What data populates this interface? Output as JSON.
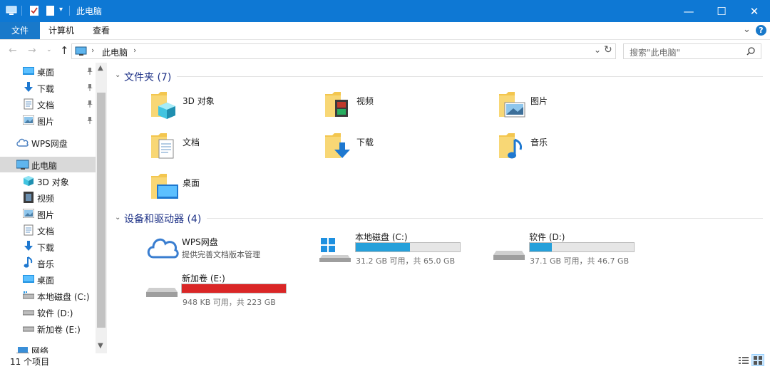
{
  "window": {
    "title": "此电脑",
    "minimize_glyph": "—",
    "maximize_glyph": "☐",
    "close_glyph": "✕"
  },
  "ribbon": {
    "tabs": [
      {
        "label": "文件",
        "active": true
      },
      {
        "label": "计算机",
        "active": false
      },
      {
        "label": "查看",
        "active": false
      }
    ],
    "expand_glyph": "⌄",
    "help_glyph": "?"
  },
  "address": {
    "path": [
      "此电脑"
    ],
    "search_placeholder": "搜索\"此电脑\""
  },
  "nav": {
    "quick_access": [
      {
        "label": "桌面",
        "icon": "desktop-icon",
        "pinned": true
      },
      {
        "label": "下载",
        "icon": "download-icon",
        "pinned": true
      },
      {
        "label": "文档",
        "icon": "document-icon",
        "pinned": true
      },
      {
        "label": "图片",
        "icon": "picture-icon",
        "pinned": true
      }
    ],
    "wps": {
      "label": "WPS网盘",
      "icon": "cloud-icon"
    },
    "this_pc": {
      "label": "此电脑",
      "icon": "computer-icon",
      "selected": true
    },
    "pc_children": [
      {
        "label": "3D 对象",
        "icon": "3d-objects-icon"
      },
      {
        "label": "视频",
        "icon": "video-icon"
      },
      {
        "label": "图片",
        "icon": "picture-icon"
      },
      {
        "label": "文档",
        "icon": "document-icon"
      },
      {
        "label": "下载",
        "icon": "download-icon"
      },
      {
        "label": "音乐",
        "icon": "music-icon"
      },
      {
        "label": "桌面",
        "icon": "desktop-icon"
      },
      {
        "label": "本地磁盘 (C:)",
        "icon": "system-drive-icon"
      },
      {
        "label": "软件 (D:)",
        "icon": "drive-icon"
      },
      {
        "label": "新加卷 (E:)",
        "icon": "drive-icon"
      }
    ],
    "network": {
      "label": "网络",
      "icon": "network-icon"
    }
  },
  "content": {
    "folders_header": "文件夹 (7)",
    "folders": [
      {
        "label": "3D 对象",
        "icon": "3d-objects-folder-icon"
      },
      {
        "label": "视频",
        "icon": "video-folder-icon"
      },
      {
        "label": "图片",
        "icon": "picture-folder-icon"
      },
      {
        "label": "文档",
        "icon": "document-folder-icon"
      },
      {
        "label": "下载",
        "icon": "download-folder-icon"
      },
      {
        "label": "音乐",
        "icon": "music-folder-icon"
      },
      {
        "label": "桌面",
        "icon": "desktop-folder-icon"
      }
    ],
    "devices_header": "设备和驱动器 (4)",
    "wps": {
      "label": "WPS网盘",
      "subtitle": "提供完善文档版本管理",
      "icon": "cloud-drive-icon"
    },
    "drives": [
      {
        "label": "本地磁盘 (C:)",
        "free": "31.2 GB 可用，共 65.0 GB",
        "used_fraction": 0.52,
        "color": "#26a0da",
        "icon": "system-drive-icon"
      },
      {
        "label": "软件 (D:)",
        "free": "37.1 GB 可用，共 46.7 GB",
        "used_fraction": 0.21,
        "color": "#26a0da",
        "icon": "drive-icon"
      },
      {
        "label": "新加卷 (E:)",
        "free": "948 KB 可用，共 223 GB",
        "used_fraction": 1.0,
        "color": "#da2626",
        "icon": "drive-icon"
      }
    ]
  },
  "status": {
    "count": "11 个项目"
  },
  "colors": {
    "accent": "#0e78d4",
    "selection": "#d9d9d9",
    "drive_ok": "#26a0da",
    "drive_full": "#da2626"
  }
}
